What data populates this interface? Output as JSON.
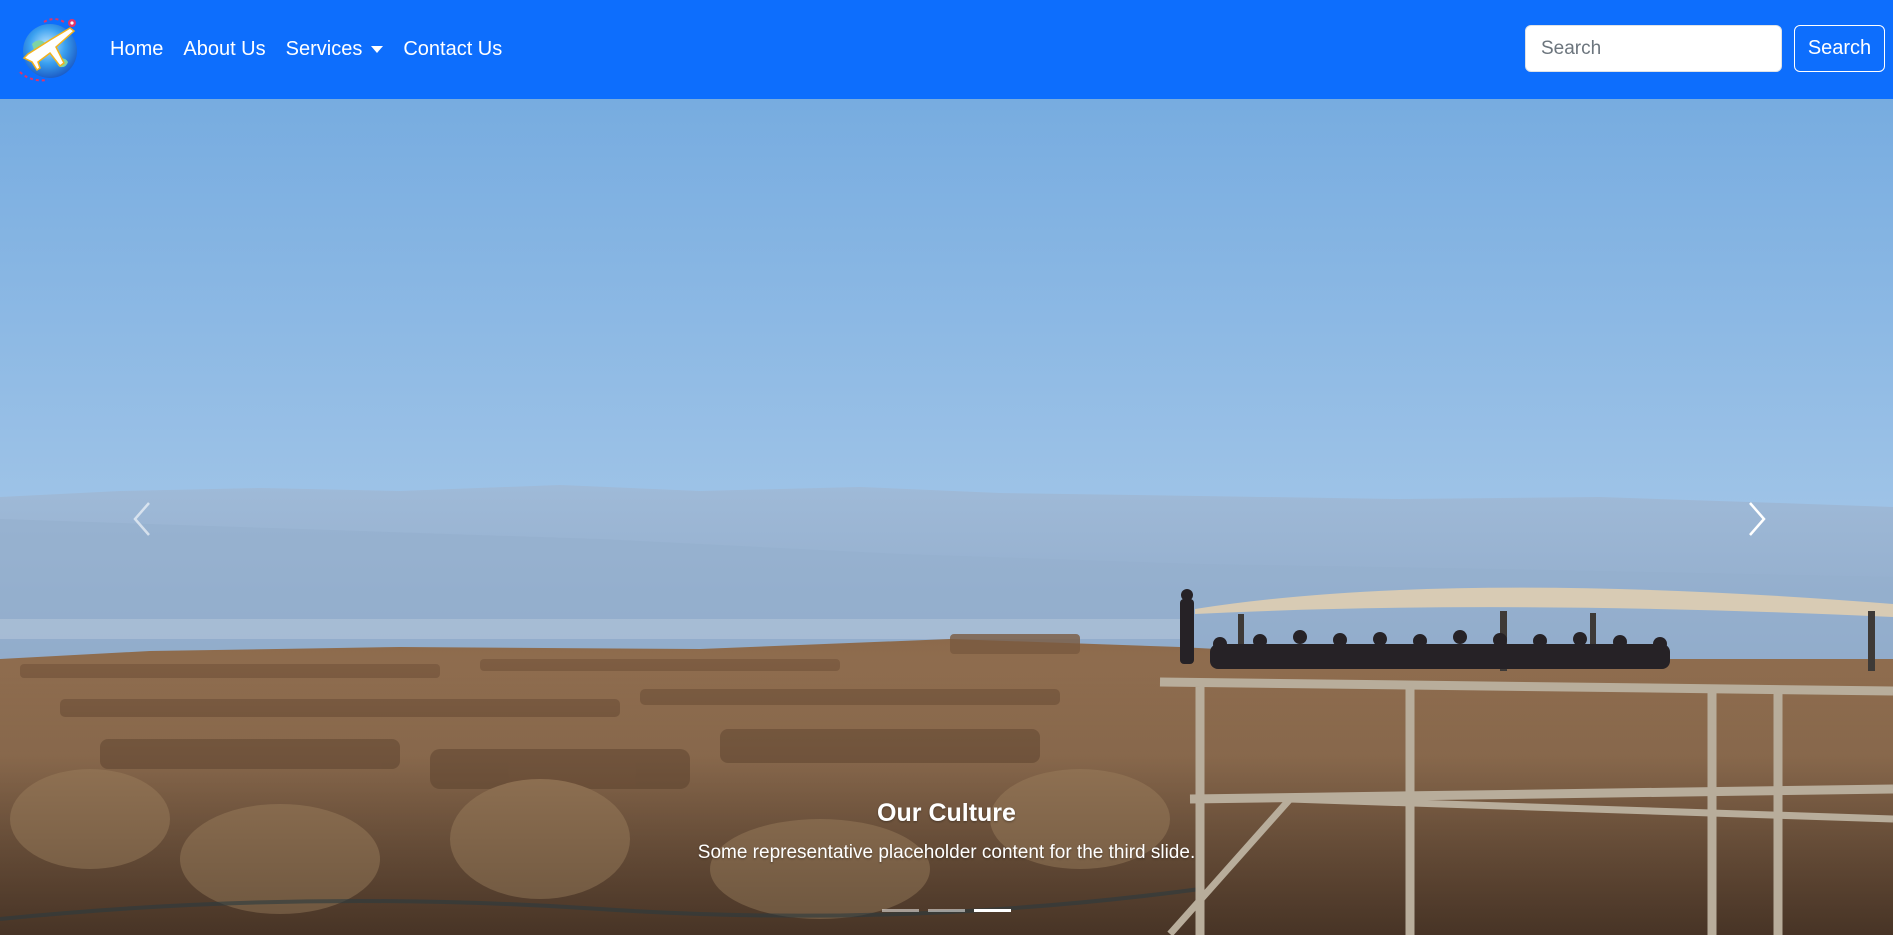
{
  "navbar": {
    "logo_icon": "travel-globe-plane-icon",
    "links": [
      {
        "label": "Home"
      },
      {
        "label": "About Us"
      },
      {
        "label": "Services",
        "has_dropdown": true
      },
      {
        "label": "Contact Us"
      }
    ],
    "search": {
      "placeholder": "Search",
      "value": "",
      "button_label": "Search"
    },
    "background_color": "#0d6efd"
  },
  "carousel": {
    "prev_icon": "chevron-left-icon",
    "next_icon": "chevron-right-icon",
    "active_slide": 3,
    "slide_count": 3,
    "caption": {
      "title": "Our Culture",
      "text": "Some representative placeholder content for the third slide."
    }
  }
}
